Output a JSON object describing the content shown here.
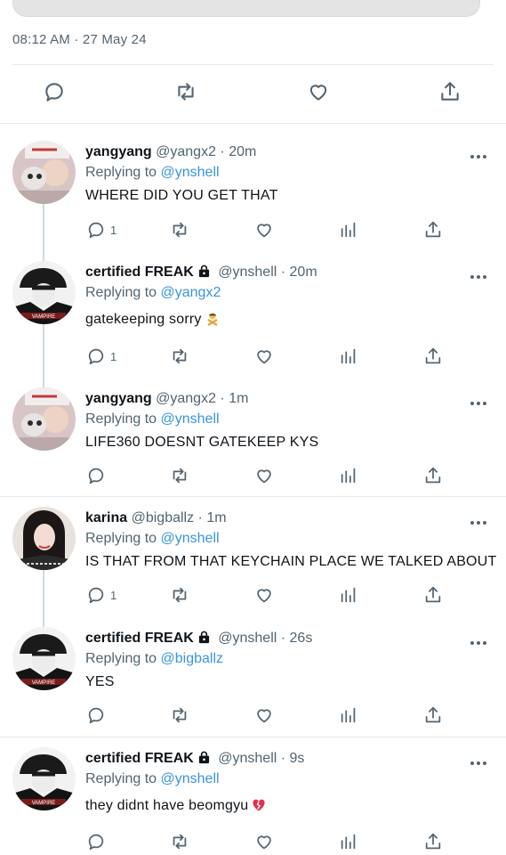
{
  "tweet": {
    "timestamp": "08:12 AM · 27 May 24"
  },
  "main_actions": {
    "reply": "reply-icon",
    "retweet": "retweet-icon",
    "like": "heart-icon",
    "share": "share-icon"
  },
  "replies": [
    {
      "display_name": "yangyang",
      "handle": "@yangx2 · 20m",
      "replying_prefix": "Replying to",
      "replying_to": "@ynshell",
      "text": "WHERE DID YOU GET THAT",
      "reply_count": "1"
    },
    {
      "display_name": "certified FREAK",
      "handle": "@ynshell · 20m",
      "replying_prefix": "Replying to",
      "replying_to": "@yangx2",
      "text": "gatekeeping sorry",
      "emoji": "person-gesturing-no-emoji",
      "reply_count": "1"
    },
    {
      "display_name": "yangyang",
      "handle": "@yangx2 · 1m",
      "replying_prefix": "Replying to",
      "replying_to": "@ynshell",
      "text": "LIFE360 DOESNT GATEKEEP KYS",
      "reply_count": ""
    },
    {
      "display_name": "karina",
      "handle": "@bigballz · 1m",
      "replying_prefix": "Replying to",
      "replying_to": "@ynshell",
      "text": "IS THAT FROM THAT KEYCHAIN PLACE WE TALKED ABOUT",
      "reply_count": "1"
    },
    {
      "display_name": "certified FREAK",
      "handle": "@ynshell · 26s",
      "replying_prefix": "Replying to",
      "replying_to": "@bigballz",
      "text": "YES",
      "reply_count": ""
    },
    {
      "display_name": "certified FREAK",
      "handle": "@ynshell · 9s",
      "replying_prefix": "Replying to",
      "replying_to": "@ynshell",
      "text": "they didnt have beomgyu",
      "emoji": "broken-heart-emoji",
      "reply_count": ""
    }
  ],
  "colors": {
    "text": "#0f1419",
    "muted": "#536471",
    "link": "#3b94d9",
    "divider": "#e6e9ec"
  }
}
